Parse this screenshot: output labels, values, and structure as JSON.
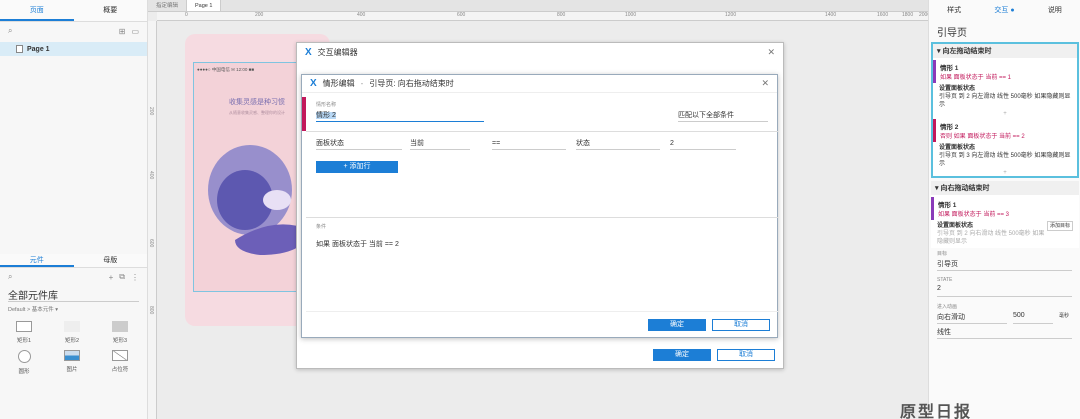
{
  "left": {
    "tabs": [
      "页面",
      "概要"
    ],
    "page": "Page 1",
    "widget_tabs": [
      "元件",
      "母版"
    ],
    "library": "全部元件库",
    "library_sub": "Default > 基本元件 ▾",
    "widgets": [
      "矩形1",
      "矩形2",
      "矩形3",
      "圆形",
      "图片",
      "占位符"
    ]
  },
  "doc_tabs": [
    "指定编辑",
    "Page 1"
  ],
  "ruler_h": [
    "0",
    "200",
    "400",
    "600",
    "800",
    "1000",
    "1200",
    "1400",
    "1600",
    "1800",
    "2000"
  ],
  "ruler_v": [
    "200",
    "400",
    "600",
    "800"
  ],
  "phone": {
    "status": "●●●●○ 中国电信 ✉   12:00   ■■",
    "title": "收集灵感是种习惯",
    "subtitle": "从随意收集灵感、整理你的设计"
  },
  "outer_dialog": {
    "title": "交互编辑器",
    "ok": "确定",
    "cancel": "取消"
  },
  "case_dialog": {
    "title": "情形编辑",
    "subtitle": "引导页: 向右拖动结束时",
    "name_label": "情形名称",
    "name_value": "情形 2",
    "match": "匹配以下全部条件",
    "cond": [
      "面板状态",
      "当前",
      "==",
      "状态",
      "2"
    ],
    "add_row": "+ 添加行",
    "cond_label": "条件",
    "cond_text": "如果 面板状态于 当前 == 2",
    "ok": "确定",
    "cancel": "取消"
  },
  "right": {
    "tabs": [
      "样式",
      "交互 ●",
      "说明"
    ],
    "title": "引导页",
    "event1": "向左拖动结束时",
    "e1c1": {
      "name": "情形 1",
      "cond": "如果 面板状态于 当前 == 1",
      "action": "设置面板状态",
      "detail": "引导页 到 2 向左滑动 线性 500毫秒 如果隐藏则显示"
    },
    "e1c2": {
      "name": "情形 2",
      "cond": "否则 如果 面板状态于 当前 == 2",
      "action": "设置面板状态",
      "detail": "引导页 到 3 向左滑动 线性 500毫秒 如果隐藏则显示"
    },
    "event2": "向右拖动结束时",
    "e2c1": {
      "name": "情形 1",
      "cond": "如果 面板状态于 当前 == 3",
      "action": "设置面板状态",
      "add": "添加目标",
      "detail": "引导页 到 2 向右滑动 线性 500毫秒 如果隐藏则显示"
    },
    "target_label": "目标",
    "target": "引导页",
    "state_label": "STATE",
    "state": "2",
    "anim_label": "进入动画",
    "anim": "向右滑动",
    "ms": "500",
    "ms_unit": "毫秒",
    "ease": "线性"
  },
  "watermark": "原型日报"
}
